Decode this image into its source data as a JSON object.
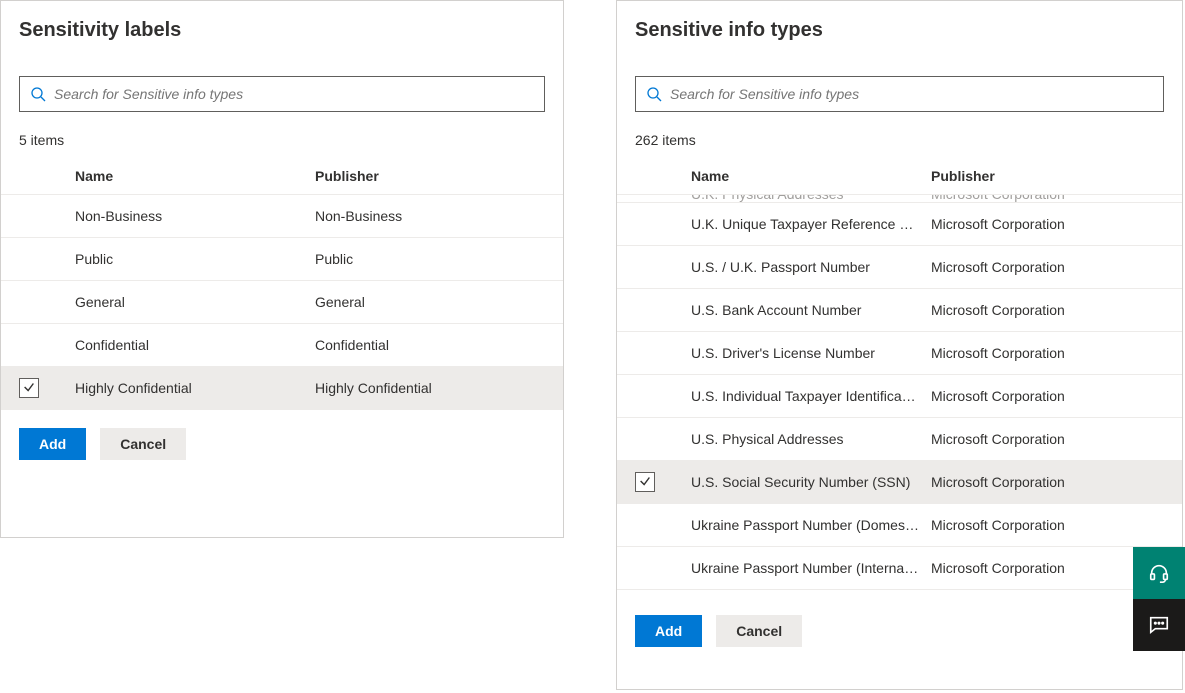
{
  "leftPanel": {
    "title": "Sensitivity labels",
    "searchPlaceholder": "Search for Sensitive info types",
    "itemCount": "5 items",
    "headers": {
      "name": "Name",
      "publisher": "Publisher"
    },
    "rows": [
      {
        "name": "Non-Business",
        "publisher": "Non-Business",
        "selected": false
      },
      {
        "name": "Public",
        "publisher": "Public",
        "selected": false
      },
      {
        "name": "General",
        "publisher": "General",
        "selected": false
      },
      {
        "name": "Confidential",
        "publisher": "Confidential",
        "selected": false
      },
      {
        "name": "Highly Confidential",
        "publisher": "Highly Confidential",
        "selected": true
      }
    ],
    "addLabel": "Add",
    "cancelLabel": "Cancel"
  },
  "rightPanel": {
    "title": "Sensitive info types",
    "searchPlaceholder": "Search for Sensitive info types",
    "itemCount": "262 items",
    "headers": {
      "name": "Name",
      "publisher": "Publisher"
    },
    "truncatedTop": {
      "name": "U.K. Physical Addresses",
      "publisher": "Microsoft Corporation"
    },
    "rows": [
      {
        "name": "U.K. Unique Taxpayer Reference Number",
        "publisher": "Microsoft Corporation",
        "selected": false
      },
      {
        "name": "U.S. / U.K. Passport Number",
        "publisher": "Microsoft Corporation",
        "selected": false
      },
      {
        "name": "U.S. Bank Account Number",
        "publisher": "Microsoft Corporation",
        "selected": false
      },
      {
        "name": "U.S. Driver's License Number",
        "publisher": "Microsoft Corporation",
        "selected": false
      },
      {
        "name": "U.S. Individual Taxpayer Identification N...",
        "publisher": "Microsoft Corporation",
        "selected": false
      },
      {
        "name": "U.S. Physical Addresses",
        "publisher": "Microsoft Corporation",
        "selected": false
      },
      {
        "name": "U.S. Social Security Number (SSN)",
        "publisher": "Microsoft Corporation",
        "selected": true
      },
      {
        "name": "Ukraine Passport Number (Domestic)",
        "publisher": "Microsoft Corporation",
        "selected": false
      },
      {
        "name": "Ukraine Passport Number (International)",
        "publisher": "Microsoft Corporation",
        "selected": false
      }
    ],
    "addLabel": "Add",
    "cancelLabel": "Cancel"
  }
}
